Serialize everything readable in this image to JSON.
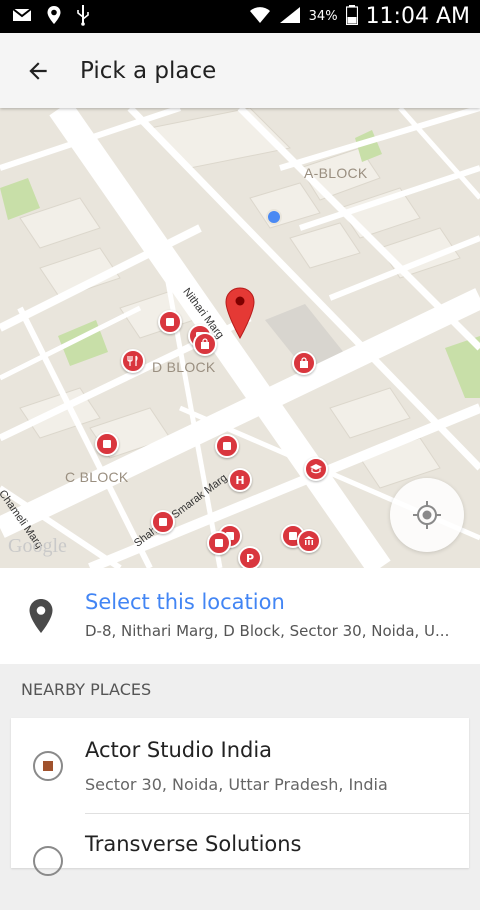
{
  "status_bar": {
    "battery_percent": "34%",
    "time": "11:04 AM",
    "icons_left": [
      "mail-icon",
      "location-icon",
      "usb-icon"
    ],
    "icons_right": [
      "wifi-icon",
      "signal-icon",
      "battery-icon"
    ]
  },
  "app_bar": {
    "title": "Pick a place",
    "back_icon": "arrow-back-icon"
  },
  "map": {
    "area_labels": {
      "a_block": "A-BLOCK",
      "d_block": "D BLOCK",
      "c_block": "C BLOCK"
    },
    "street_labels": {
      "nithari": "Nithari Marg",
      "shaheed": "Shaheed Smarak Marg",
      "chameli": "Chameli Marg"
    },
    "attribution": "Google",
    "poi_markers": {
      "hospital": "H",
      "parking": "P"
    },
    "colors": {
      "land": "#e9e5dc",
      "road": "#ffffff",
      "park": "#c8dfa8",
      "poi": "#d9363e",
      "user_location": "#4a89f3"
    }
  },
  "select_location": {
    "title": "Select this location",
    "address": "D-8, Nithari Marg, D Block, Sector 30, Noida, U..."
  },
  "nearby": {
    "header": "NEARBY PLACES",
    "places": [
      {
        "name": "Actor Studio India",
        "address": "Sector 30, Noida, Uttar Pradesh, India"
      },
      {
        "name": "Transverse Solutions",
        "address": ""
      }
    ]
  }
}
